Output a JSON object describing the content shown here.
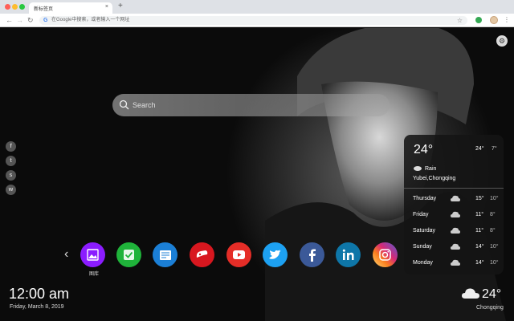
{
  "browser": {
    "tab_title": "新标签页",
    "tab_close": "×",
    "new_tab": "+",
    "nav_back": "←",
    "nav_forward": "→",
    "nav_reload": "↻",
    "omnibox_g": "G",
    "omnibox_placeholder": "在Google中搜索，或者输入一个网址",
    "star": "☆",
    "menu": "⋮"
  },
  "search": {
    "placeholder": "Search"
  },
  "settings": {
    "glyph": "⚙"
  },
  "social": [
    {
      "name": "facebook-icon",
      "glyph": "f"
    },
    {
      "name": "twitter-icon",
      "glyph": "t"
    },
    {
      "name": "snapchat-icon",
      "glyph": "s"
    },
    {
      "name": "wechat-icon",
      "glyph": "w"
    }
  ],
  "weather": {
    "temp": "24°",
    "high": "24°",
    "low": "7°",
    "condition": "Rain",
    "location": "Yubei,Chongqing",
    "forecast": [
      {
        "day": "Thursday",
        "high": "15°",
        "low": "10°"
      },
      {
        "day": "Friday",
        "high": "11°",
        "low": "8°"
      },
      {
        "day": "Saturday",
        "high": "11°",
        "low": "8°"
      },
      {
        "day": "Sunday",
        "high": "14°",
        "low": "10°"
      },
      {
        "day": "Monday",
        "high": "14°",
        "low": "10°"
      }
    ]
  },
  "dock": {
    "prev": "‹",
    "first_label": "图库",
    "apps": [
      {
        "name": "gallery",
        "color": "#8b1cff"
      },
      {
        "name": "tasks",
        "color": "#1fb33a"
      },
      {
        "name": "news",
        "color": "#1b7fd6"
      },
      {
        "name": "games",
        "color": "#d8171f"
      },
      {
        "name": "youtube",
        "color": "#e52d27"
      },
      {
        "name": "twitter",
        "color": "#1da1f2"
      },
      {
        "name": "facebook",
        "color": "#3b5998"
      },
      {
        "name": "linkedin",
        "color": "#0e76a8"
      },
      {
        "name": "instagram",
        "color": "#d62976"
      }
    ]
  },
  "clock": {
    "time": "12:00 am",
    "date": "Friday, March 8, 2019"
  },
  "current": {
    "temp": "24°",
    "city": "Chongqing"
  }
}
